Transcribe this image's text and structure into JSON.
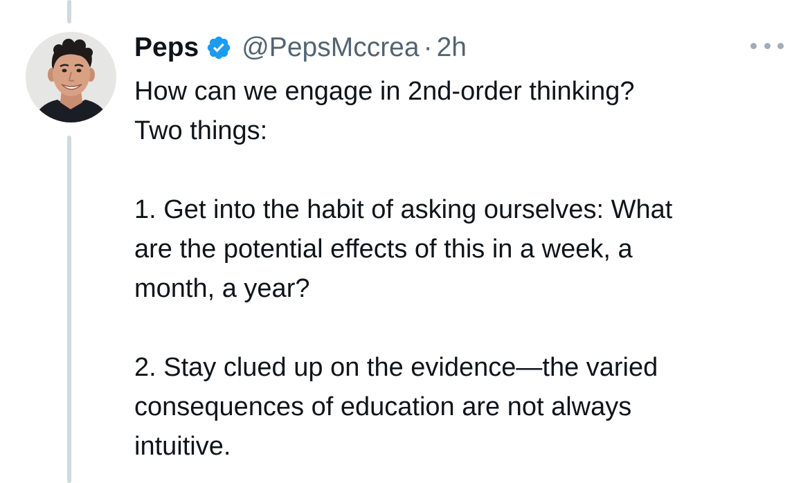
{
  "tweet": {
    "author": {
      "name": "Peps",
      "handle": "@PepsMccrea",
      "verified": true
    },
    "separator": "·",
    "time": "2h",
    "body": {
      "line1": "How can we engage in 2nd-order thinking?",
      "line2": "Two things:",
      "point1_line1": "1. Get into the habit of asking ourselves: What",
      "point1_line2": "are the potential effects of this in a week, a",
      "point1_line3": "month, a year?",
      "point2_line1": "2. Stay clued up on the evidence—the varied",
      "point2_line2": "consequences of education are not always",
      "point2_line3": "intuitive."
    }
  },
  "icons": {
    "verified": "verified-badge-icon",
    "more": "more-options-icon"
  },
  "colors": {
    "text_primary": "#0f1419",
    "text_secondary": "#536471",
    "verified_blue": "#1d9bf0",
    "thread_line": "#cfd9de"
  }
}
